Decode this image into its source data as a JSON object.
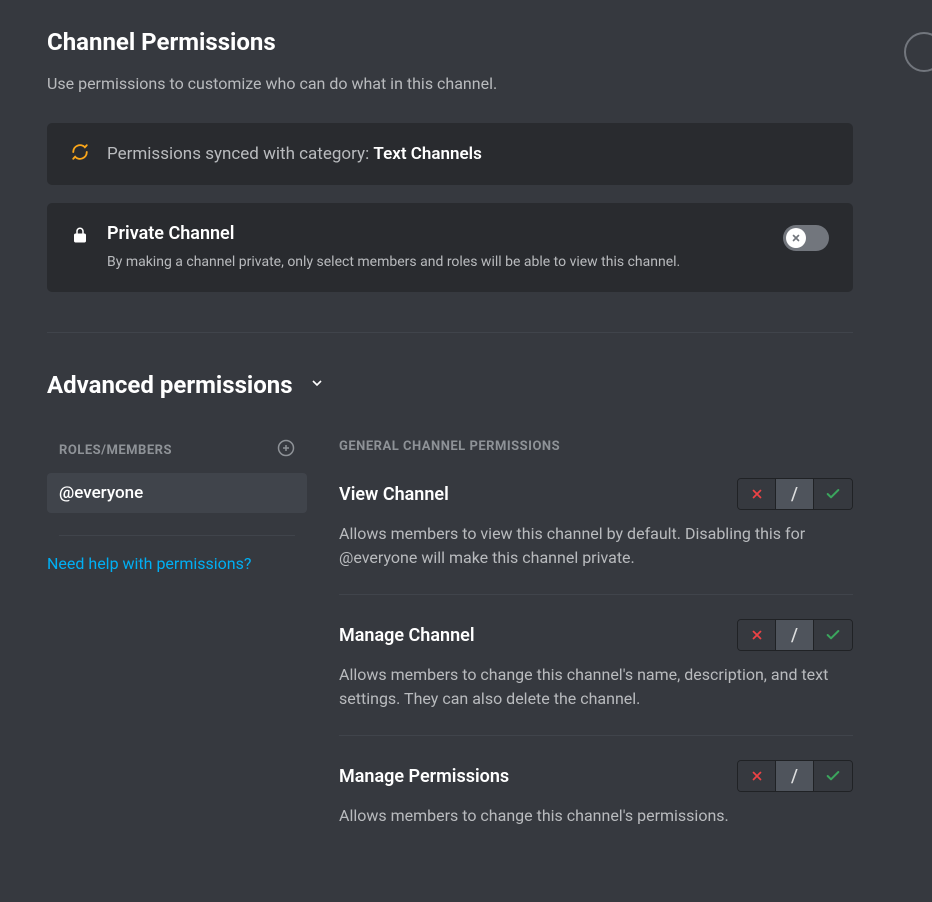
{
  "header": {
    "title": "Channel Permissions",
    "subtitle": "Use permissions to customize who can do what in this channel."
  },
  "sync": {
    "prefix": "Permissions synced with category: ",
    "category": "Text Channels"
  },
  "private": {
    "title": "Private Channel",
    "description": "By making a channel private, only select members and roles will be able to view this channel.",
    "enabled": false
  },
  "advanced": {
    "title": "Advanced permissions"
  },
  "roles": {
    "header": "Roles/Members",
    "items": [
      {
        "label": "@everyone",
        "selected": true
      }
    ],
    "help": "Need help with permissions?"
  },
  "perms": {
    "section": "General Channel Permissions",
    "items": [
      {
        "name": "View Channel",
        "description": "Allows members to view this channel by default. Disabling this for @everyone will make this channel private.",
        "state": "neutral"
      },
      {
        "name": "Manage Channel",
        "description": "Allows members to change this channel's name, description, and text settings. They can also delete the channel.",
        "state": "neutral"
      },
      {
        "name": "Manage Permissions",
        "description": "Allows members to change this channel's permissions.",
        "state": "neutral"
      }
    ]
  }
}
